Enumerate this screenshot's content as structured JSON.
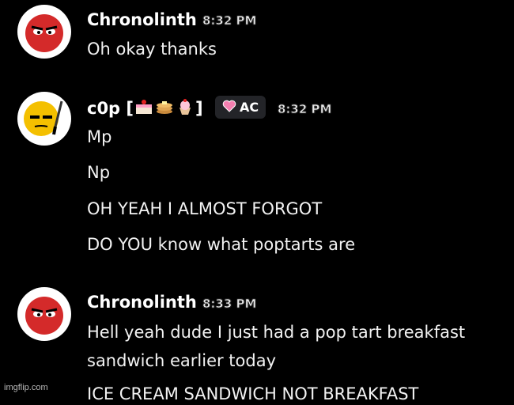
{
  "messages": [
    {
      "author": "Chronolinth",
      "timestamp": "8:32 PM",
      "avatar_icon": "red-face-icon",
      "lines": [
        "Oh okay thanks"
      ]
    },
    {
      "author_name": "c0p",
      "author_bracket_open": "[",
      "author_bracket_close": "]",
      "author_emojis": [
        "cake-icon",
        "pancakes-icon",
        "cupcake-icon"
      ],
      "badge_label": "AC",
      "badge_icon": "heart-icon",
      "timestamp": "8:32 PM",
      "avatar_icon": "yellow-face-knife-icon",
      "lines": [
        "Mp",
        "Np",
        "OH YEAH I ALMOST FORGOT",
        "DO YOU know what poptarts are"
      ]
    },
    {
      "author": "Chronolinth",
      "timestamp": "8:33 PM",
      "avatar_icon": "red-face-icon",
      "lines": [
        "Hell yeah dude I just had a pop tart breakfast",
        "sandwich earlier today",
        "ICE CREAM SANDWICH NOT BREAKFAST"
      ]
    }
  ],
  "watermark": "imgflip.com",
  "colors": {
    "background": "#000000",
    "badge_bg": "#232428",
    "avatar_red": "#d42a2a",
    "avatar_yellow": "#f4c000",
    "heart_pink": "#f47fb0"
  }
}
